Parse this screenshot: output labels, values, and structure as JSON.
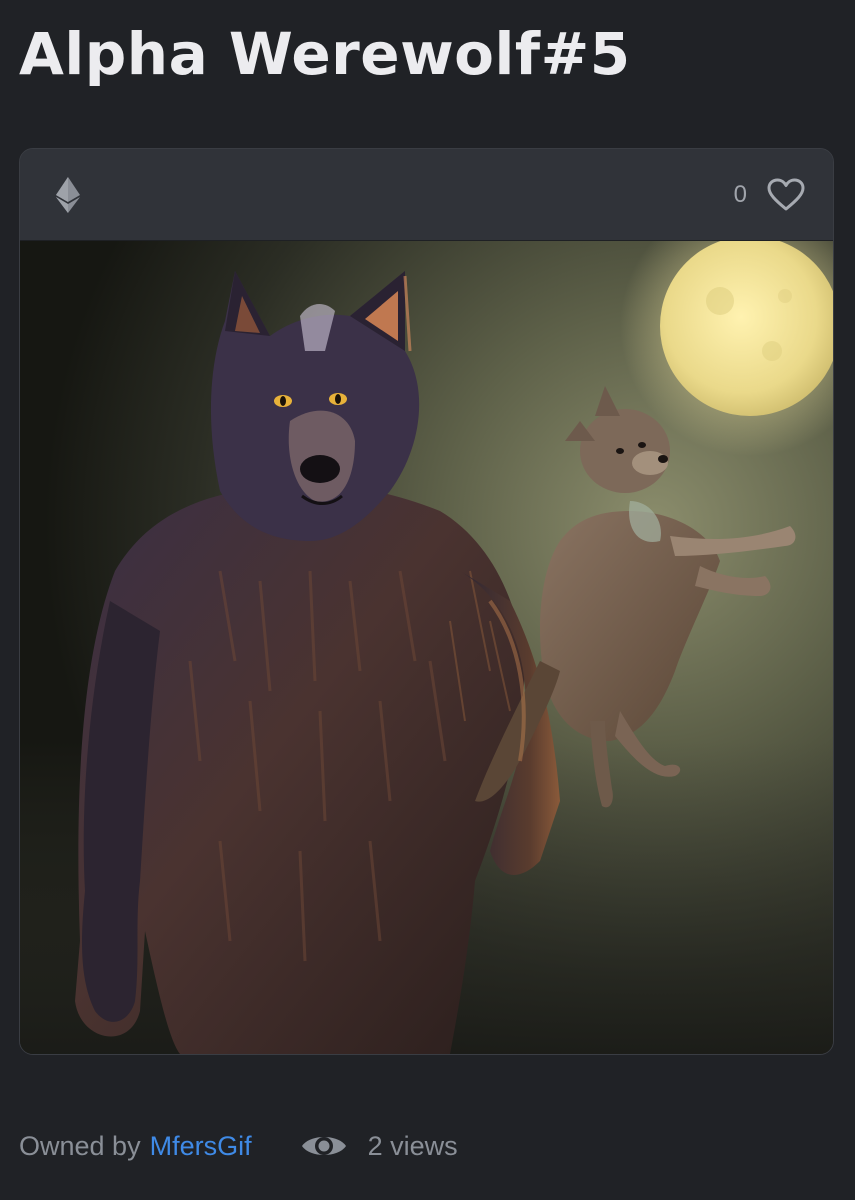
{
  "page": {
    "title": "Alpha Werewolf#5"
  },
  "card": {
    "currency_icon": "ethereum-icon",
    "like_count": "0",
    "like_icon": "heart-outline-icon",
    "image_alt": "Alpha Werewolf#5"
  },
  "footer": {
    "owned_by_label": "Owned by",
    "owner_name": "MfersGif",
    "views_icon": "eye-icon",
    "views_text": "2 views"
  },
  "colors": {
    "background": "#202226",
    "card": "#303339",
    "link": "#3f8ae6",
    "muted_text": "#8a8f97"
  }
}
